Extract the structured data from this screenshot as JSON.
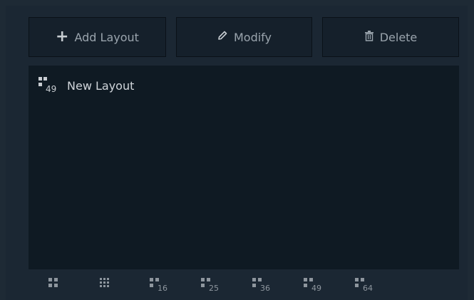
{
  "toolbar": {
    "add_label": "Add Layout",
    "modify_label": "Modify",
    "delete_label": "Delete",
    "add_icon": "plus-icon",
    "modify_icon": "pencil-icon",
    "delete_icon": "trash-icon"
  },
  "layouts": [
    {
      "name": "New Layout",
      "grid": "49"
    }
  ],
  "grid_options": [
    "4",
    "9",
    "16",
    "25",
    "36",
    "49",
    "64"
  ],
  "colors": {
    "background": "#1e2a35",
    "list_bg": "#0f1a23",
    "button_bg": "#15202b",
    "text": "#9aa4ad"
  }
}
